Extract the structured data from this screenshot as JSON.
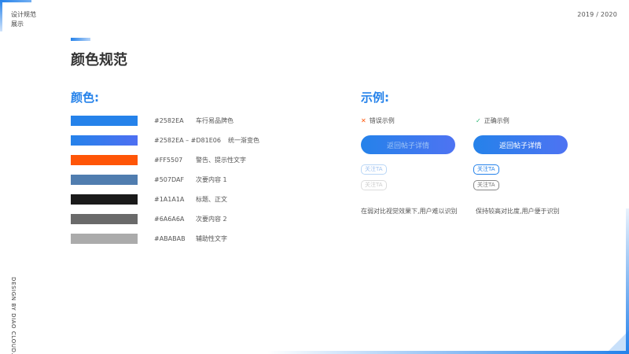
{
  "header": {
    "title_line1": "设计规范",
    "title_line2": "展示",
    "year": "2019 / 2020"
  },
  "page_title": "颜色规范",
  "colors_section": {
    "title": "颜色:",
    "items": [
      {
        "hex": "#2582EA",
        "usage": "车行易品牌色",
        "swatch": "#2582EA"
      },
      {
        "hex": "#2582EA – #D81E06",
        "usage": "统一渐变色",
        "swatch_from": "#2582EA",
        "swatch_to": "#4e6ff2"
      },
      {
        "hex": "#FF5507",
        "usage": "警告、提示性文字",
        "swatch": "#FF5507"
      },
      {
        "hex": "#507DAF",
        "usage": "次要内容 1",
        "swatch": "#507DAF"
      },
      {
        "hex": "#1A1A1A",
        "usage": "标题、正文",
        "swatch": "#1A1A1A"
      },
      {
        "hex": "#6A6A6A",
        "usage": "次要内容 2",
        "swatch": "#6A6A6A"
      },
      {
        "hex": "#ABABAB",
        "usage": "辅助性文字",
        "swatch": "#ABABAB"
      }
    ]
  },
  "examples_section": {
    "title": "示例:",
    "wrong": {
      "label": "错误示例",
      "icon": "cross-icon",
      "button_label": "返回帖子详情",
      "tag1": "关注TA",
      "tag2": "关注TA",
      "note": "在弱对比视觉效果下,用户难以识别"
    },
    "right": {
      "label": "正确示例",
      "icon": "check-icon",
      "button_label": "返回帖子详情",
      "tag1": "关注TA",
      "tag2": "关注TA",
      "note": "保持较高对比度,用户便于识别"
    }
  },
  "footer": {
    "vertical_text": "DESIGN BY DIAO CLOUD."
  },
  "theme": {
    "brand": "#2582EA",
    "warning": "#FF5507"
  }
}
